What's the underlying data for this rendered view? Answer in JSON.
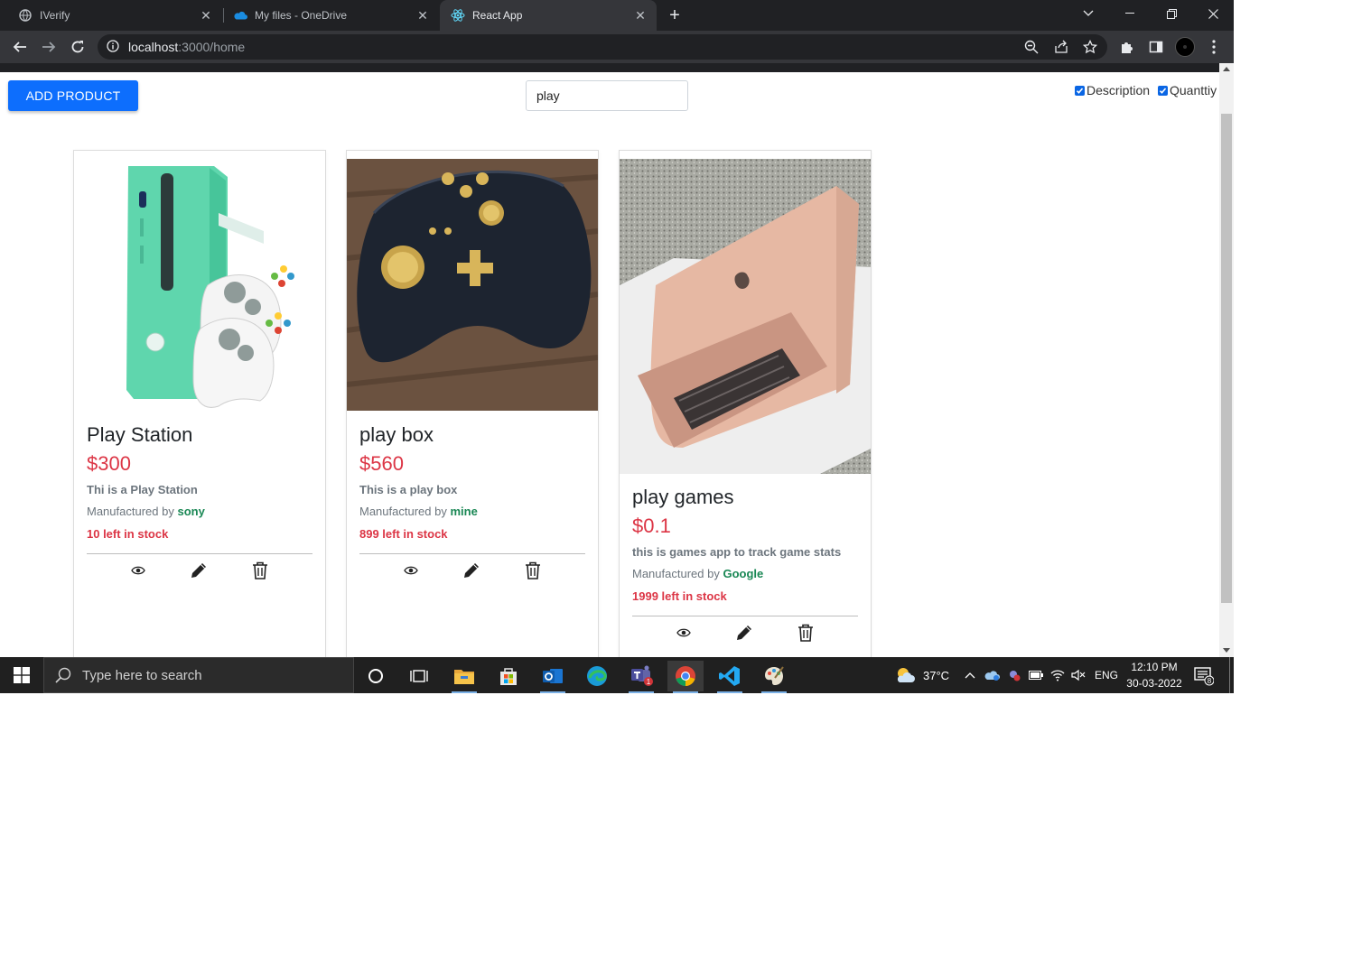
{
  "browser": {
    "tabs": [
      {
        "title": "IVerify",
        "icon": "globe-icon",
        "active": false
      },
      {
        "title": "My files - OneDrive",
        "icon": "onedrive-icon",
        "active": false
      },
      {
        "title": "React App",
        "icon": "react-icon",
        "active": true
      }
    ],
    "url_host": "localhost",
    "url_path": ":3000/home"
  },
  "page": {
    "add_product_label": "ADD PRODUCT",
    "search_value": "play",
    "filters": [
      {
        "label": "Description",
        "checked": true
      },
      {
        "label": "Quanttiy",
        "checked": true
      }
    ],
    "manufactured_by_label": "Manufactured by",
    "products": [
      {
        "name": "Play Station",
        "price": "$300",
        "description": "Thi is a Play Station",
        "manufacturer": "sony",
        "stock": "10 left in stock"
      },
      {
        "name": "play box",
        "price": "$560",
        "description": "This is a play box",
        "manufacturer": "mine",
        "stock": "899 left in stock"
      },
      {
        "name": "play games",
        "price": "$0.1",
        "description": "this is games app to track game stats",
        "manufacturer": "Google",
        "stock": "1999 left in stock"
      }
    ]
  },
  "taskbar": {
    "search_placeholder": "Type here to search",
    "weather": "37°C",
    "language": "ENG",
    "time": "12:10 PM",
    "date": "30-03-2022",
    "teams_badge": "1",
    "notification_count": "8"
  },
  "colors": {
    "primary": "#0d6efd",
    "price": "#dc3545",
    "manufacturer": "#198754"
  }
}
